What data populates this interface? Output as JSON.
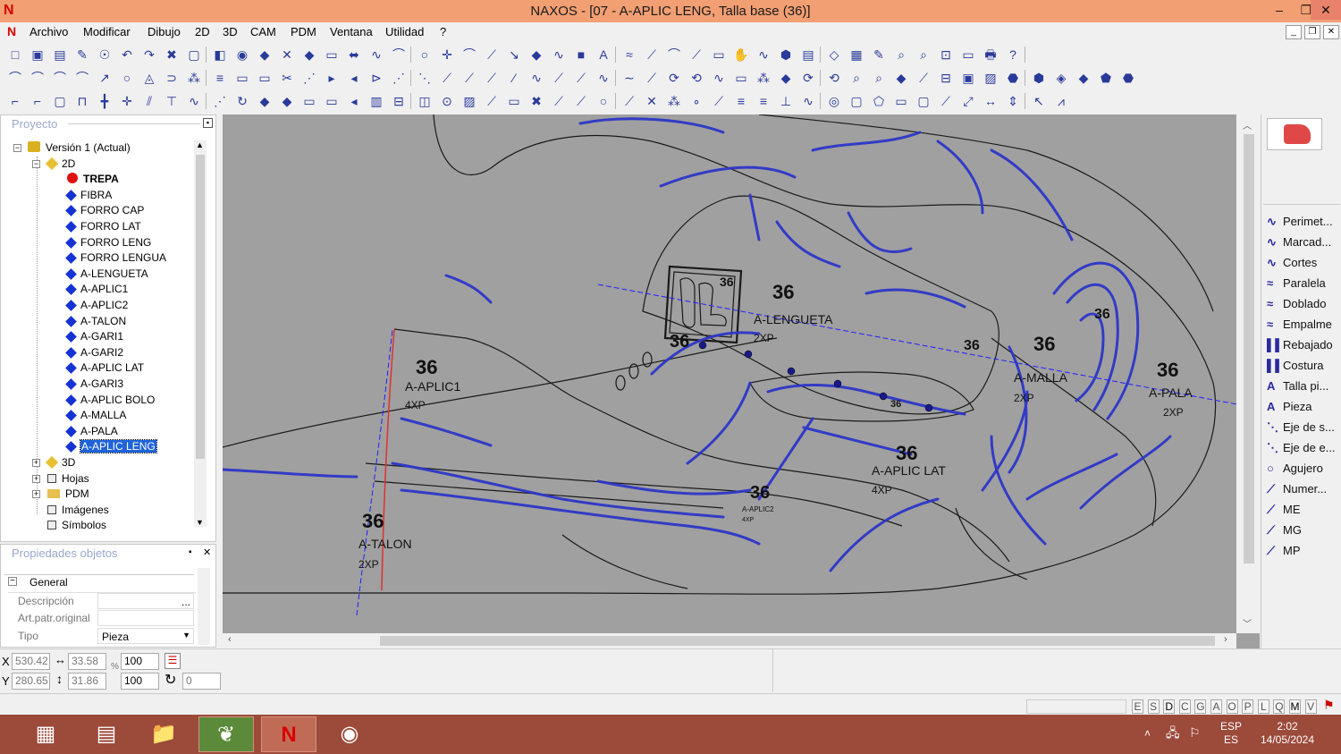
{
  "window": {
    "title": "NAXOS - [07 - A-APLIC LENG, Talla base (36)]",
    "app_logo": "N"
  },
  "menu": [
    "Archivo",
    "Modificar",
    "Dibujo",
    "2D",
    "3D",
    "CAM",
    "PDM",
    "Ventana",
    "Utilidad",
    "?"
  ],
  "project_panel": {
    "title": "Proyecto",
    "tree": [
      {
        "label": "Versión 1 (Actual)",
        "icon": "version-icon",
        "level": 0
      },
      {
        "label": "2D",
        "icon": "2d-icon",
        "level": 1
      },
      {
        "label": "TREPA",
        "icon": "red-dot",
        "level": 2,
        "bold": true
      },
      {
        "label": "FIBRA",
        "icon": "blue-diamond",
        "level": 2
      },
      {
        "label": "FORRO CAP",
        "icon": "blue-diamond",
        "level": 2
      },
      {
        "label": "FORRO LAT",
        "icon": "blue-diamond",
        "level": 2
      },
      {
        "label": "FORRO LENG",
        "icon": "blue-diamond",
        "level": 2
      },
      {
        "label": "FORRO LENGUA",
        "icon": "blue-diamond",
        "level": 2
      },
      {
        "label": "A-LENGUETA",
        "icon": "blue-diamond",
        "level": 2
      },
      {
        "label": "A-APLIC1",
        "icon": "blue-diamond",
        "level": 2
      },
      {
        "label": "A-APLIC2",
        "icon": "blue-diamond",
        "level": 2
      },
      {
        "label": "A-TALON",
        "icon": "blue-diamond",
        "level": 2
      },
      {
        "label": "A-GARI1",
        "icon": "blue-diamond",
        "level": 2
      },
      {
        "label": "A-GARI2",
        "icon": "blue-diamond",
        "level": 2
      },
      {
        "label": "A-APLIC LAT",
        "icon": "blue-diamond",
        "level": 2
      },
      {
        "label": "A-GARI3",
        "icon": "blue-diamond",
        "level": 2
      },
      {
        "label": "A-APLIC BOLO",
        "icon": "blue-diamond",
        "level": 2
      },
      {
        "label": "A-MALLA",
        "icon": "blue-diamond",
        "level": 2
      },
      {
        "label": "A-PALA",
        "icon": "blue-diamond",
        "level": 2
      },
      {
        "label": "A-APLIC LENG",
        "icon": "blue-diamond",
        "level": 2,
        "selected": true
      },
      {
        "label": "3D",
        "icon": "3d-icon",
        "level": 1
      },
      {
        "label": "Hojas",
        "icon": "sheets-icon",
        "level": 1
      },
      {
        "label": "PDM",
        "icon": "folder-icon",
        "level": 1
      },
      {
        "label": "Imágenes",
        "icon": "images-icon",
        "level": 1
      },
      {
        "label": "Símbolos",
        "icon": "symbols-icon",
        "level": 1
      }
    ]
  },
  "properties_panel": {
    "title": "Propiedades objetos",
    "group": "General",
    "rows": [
      {
        "label": "Descripción",
        "value": "",
        "has_ellipsis": true
      },
      {
        "label": "Art.patr.original",
        "value": ""
      },
      {
        "label": "Tipo",
        "value": "Pieza",
        "dropdown": true
      }
    ]
  },
  "canvas": {
    "pieces": [
      {
        "size": "36",
        "name": "A-LENGUETA",
        "qty": "2XP"
      },
      {
        "size": "36",
        "name": "A-APLIC1",
        "qty": "4XP"
      },
      {
        "size": "36",
        "name": "A-TALON",
        "qty": "2XP"
      },
      {
        "size": "36",
        "name": "A-MALLA",
        "qty": "2XP"
      },
      {
        "size": "36",
        "name": "A-PALA",
        "qty": "2XP"
      },
      {
        "size": "36",
        "name": "A-APLIC LAT",
        "qty": "4XP"
      },
      {
        "size": "36",
        "name": "A-APLIC2",
        "qty": "4XP"
      }
    ],
    "small_labels": [
      "36",
      "36",
      "36",
      "36",
      "36"
    ],
    "colors": {
      "background": "#a0a0a0",
      "outline": "#1a1a1a",
      "stitch": "#2d36c8",
      "axis": "#2020ff",
      "heel_line": "#e03030"
    }
  },
  "right_tools": [
    "Perimet...",
    "Marcad...",
    "Cortes",
    "Paralela",
    "Doblado",
    "Empalme",
    "Rebajado",
    "Costura",
    "Talla pi...",
    "Pieza",
    "Eje de s...",
    "Eje de e...",
    "Agujero",
    "Numer...",
    "ME",
    "MG",
    "MP"
  ],
  "coords": {
    "x_label": "X",
    "y_label": "Y",
    "x": "530.42",
    "y": "280.65",
    "w": "33.58",
    "h": "31.86",
    "sx": "100",
    "sy": "100",
    "rot": "0"
  },
  "status_flags": [
    "E",
    "S",
    "D",
    "C",
    "G",
    "A",
    "O",
    "P",
    "L",
    "Q",
    "M",
    "V"
  ],
  "tray": {
    "lang_top": "ESP",
    "lang_bottom": "ES",
    "time": "2:02",
    "date": "14/05/2024"
  }
}
